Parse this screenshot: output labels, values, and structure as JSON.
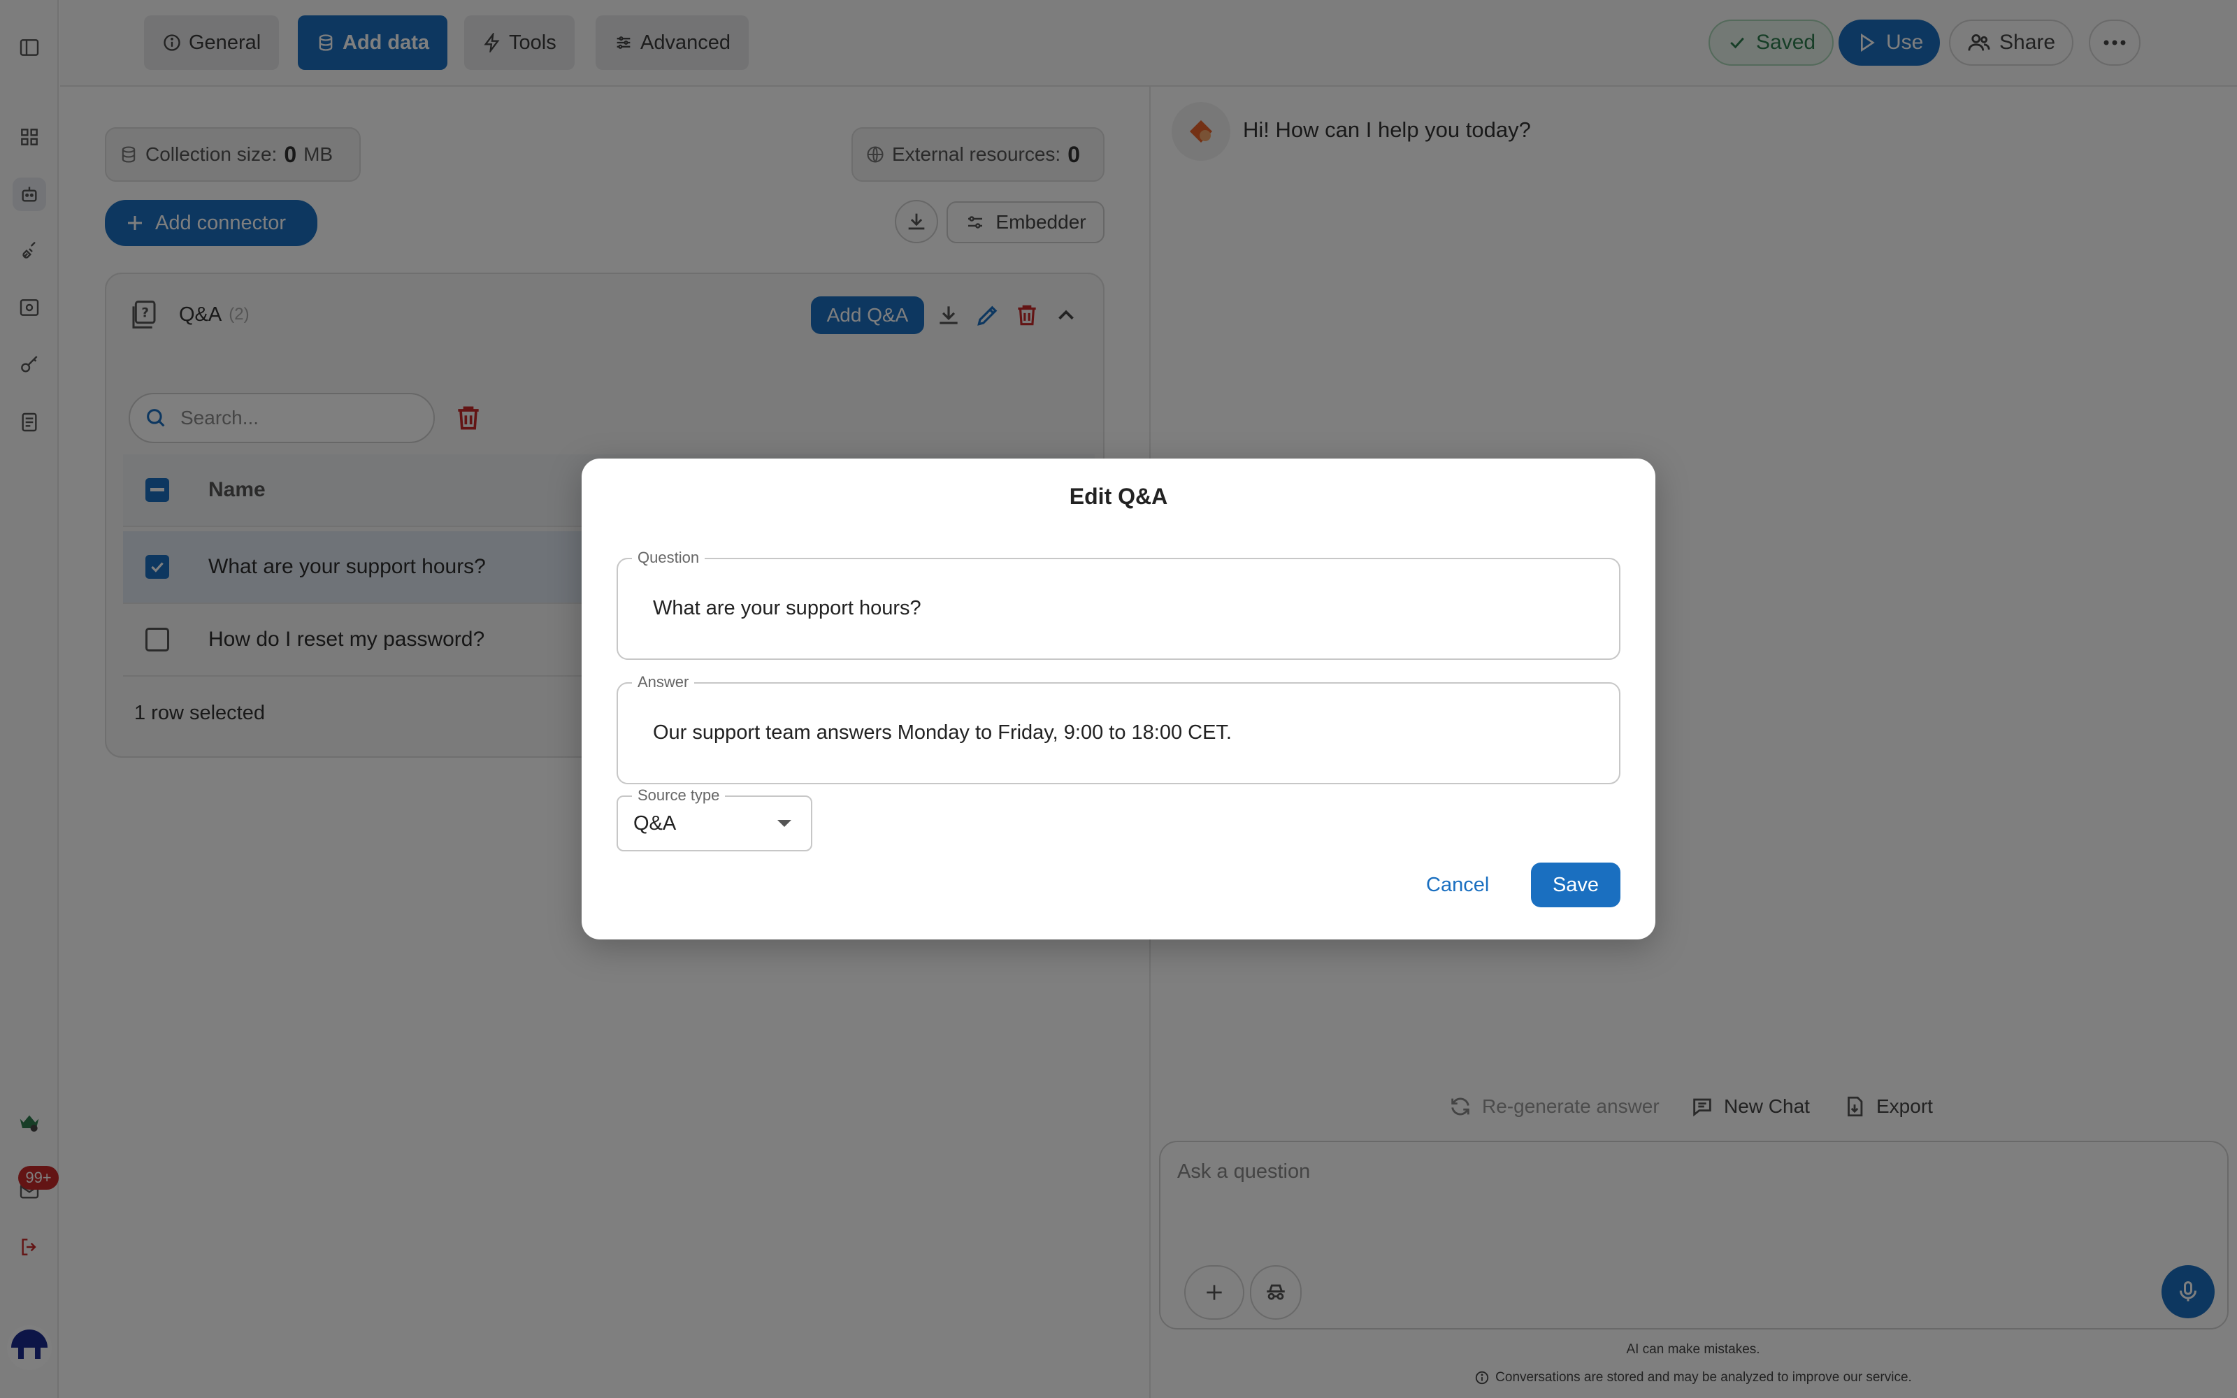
{
  "tabs": [
    {
      "label": "General",
      "icon": "info-icon"
    },
    {
      "label": "Add data",
      "icon": "database-icon"
    },
    {
      "label": "Tools",
      "icon": "bolt-icon"
    },
    {
      "label": "Advanced",
      "icon": "sliders-icon"
    }
  ],
  "topbar": {
    "saved_label": "Saved",
    "use_label": "Use",
    "share_label": "Share"
  },
  "sidebar": {
    "badge": "99+"
  },
  "left": {
    "collection_size_label": "Collection size:",
    "collection_size_value": "0",
    "collection_size_unit": "MB",
    "external_label": "External resources:",
    "external_value": "0",
    "add_connector_label": "Add connector",
    "embedder_label": "Embedder",
    "qa_title": "Q&A",
    "qa_count": "(2)",
    "add_qa_label": "Add Q&A",
    "search_placeholder": "Search...",
    "table": {
      "header": "Name",
      "rows": [
        {
          "name": "What are your support hours?",
          "checked": true
        },
        {
          "name": "How do I reset my password?",
          "checked": false
        }
      ],
      "footer": "1 row selected"
    }
  },
  "chat": {
    "greeting": "Hi! How can I help you today?",
    "regenerate_label": "Re-generate answer",
    "new_chat_label": "New Chat",
    "export_label": "Export",
    "input_placeholder": "Ask a question",
    "disclaimer": "AI can make mistakes.",
    "privacy_note": "Conversations are stored and may be analyzed to improve our service."
  },
  "modal": {
    "title": "Edit Q&A",
    "question_label": "Question",
    "question_value": "What are your support hours?",
    "answer_label": "Answer",
    "answer_value": "Our support team answers Monday to Friday, 9:00 to 18:00 CET.",
    "source_type_label": "Source type",
    "source_type_value": "Q&A",
    "cancel_label": "Cancel",
    "save_label": "Save"
  },
  "colors": {
    "primary": "#1a6fc0",
    "danger": "#c62828",
    "saved_green": "#2e7d4f"
  }
}
